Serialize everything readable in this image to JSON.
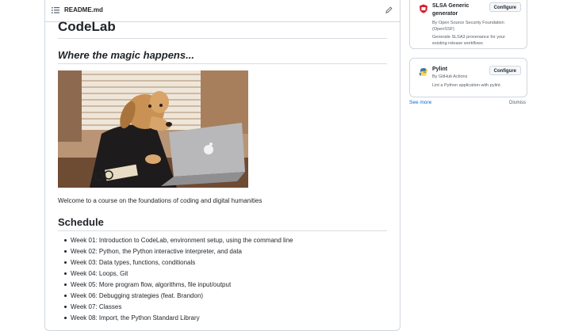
{
  "readme": {
    "filename": "README.md",
    "title": "CodeLab",
    "tagline": "Where the magic happens...",
    "image_alt": "dog at laptop",
    "welcome": "Welcome to a course on the foundations of coding and digital humanities",
    "schedule_heading": "Schedule",
    "schedule": [
      "Week 01: Introduction to CodeLab, environment setup, using the command line",
      "Week 02: Python, the Python interactive interpreter, and data",
      "Week 03: Data types, functions, conditionals",
      "Week 04: Loops, Git",
      "Week 05: More program flow, algorithms, file input/output",
      "Week 06: Debugging strategies (feat. Brandon)",
      "Week 07: Classes",
      "Week 08: Import, the Python Standard Library"
    ]
  },
  "sidebar": {
    "cards": [
      {
        "title": "SLSA Generic generator",
        "author": "By Open Source Security Foundation (OpenSSF)",
        "description": "Generate SLSA3 provenance for your existing release workflows",
        "button": "Configure",
        "icon": "slsa-shield-icon",
        "icon_color": "#d1242f"
      },
      {
        "title": "Pylint",
        "author": "By GitHub Actions",
        "description": "Lint a Python application with pylint.",
        "button": "Configure",
        "icon": "python-icon"
      }
    ],
    "see_more": "See more",
    "dismiss": "Dismiss"
  },
  "colors": {
    "link": "#0969da",
    "border": "#d0d7de",
    "text": "#1f2328",
    "muted": "#57606a"
  }
}
